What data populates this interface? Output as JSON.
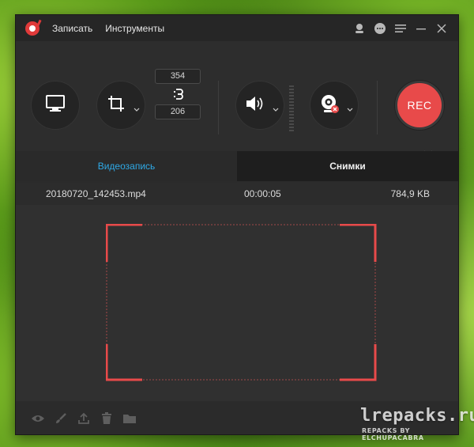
{
  "titlebar": {
    "menu": [
      "Записать",
      "Инструменты"
    ],
    "icons": [
      "user-icon",
      "chat-icon",
      "menu-icon",
      "minimize-icon",
      "close-icon"
    ]
  },
  "controls": {
    "screen_icon": "monitor-icon",
    "region_icon": "crop-icon",
    "width": "354",
    "height": "206",
    "audio_icon": "speaker-icon",
    "webcam_icon": "webcam-icon",
    "rec_label": "REC",
    "list_icon": "list-icon",
    "schedule_icons": [
      "clock-icon",
      "alarm-icon"
    ]
  },
  "tabs": [
    {
      "label": "Видеозапись",
      "active": true
    },
    {
      "label": "Снимки",
      "active": false
    }
  ],
  "file": {
    "name": "20180720_142453.mp4",
    "duration": "00:00:05",
    "size": "784,9 KB"
  },
  "bottom_icons": [
    "eye-icon",
    "brush-icon",
    "upload-icon",
    "trash-icon",
    "folder-icon"
  ],
  "colors": {
    "accent": "#2fa9e6",
    "rec": "#e84a4a",
    "frame": "#e84a4a"
  },
  "watermark": {
    "main": "lrepacks.ru",
    "sub": "REPACKS BY ELCHUPACABRA"
  }
}
